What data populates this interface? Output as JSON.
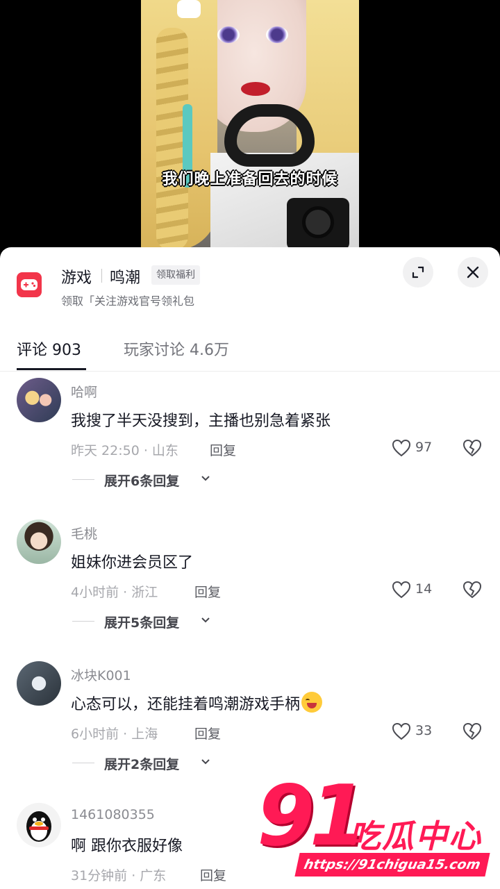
{
  "video": {
    "subtitle": "我们晚上准备回去的时候"
  },
  "game": {
    "icon": "gamepad-icon",
    "name": "游戏",
    "title": "鸣潮",
    "badge": "领取福利",
    "description": "领取「关注游戏官号领礼包"
  },
  "header_buttons": {
    "expand_icon": "expand-icon",
    "close_icon": "close-icon"
  },
  "tabs": [
    {
      "label": "评论 903",
      "active": true
    },
    {
      "label": "玩家讨论 4.6万",
      "active": false
    }
  ],
  "comments": [
    {
      "user": "哈啊",
      "text": "我搜了半天没搜到，主播也别急着紧张",
      "meta": "昨天 22:50 · 山东",
      "reply_label": "回复",
      "likes": "97",
      "expand": "展开6条回复"
    },
    {
      "user": "毛桃",
      "text": "姐妹你进会员区了",
      "meta": "4小时前 · 浙江",
      "reply_label": "回复",
      "likes": "14",
      "expand": "展开5条回复"
    },
    {
      "user": "冰块K001",
      "text": "心态可以，还能挂着鸣潮游戏手柄",
      "emoji": "laughing-crying-emoji",
      "meta": "6小时前 · 上海",
      "reply_label": "回复",
      "likes": "33",
      "expand": "展开2条回复"
    },
    {
      "user": "1461080355",
      "text": "啊 跟你衣服好像",
      "meta": "31分钟前 · 广东",
      "reply_label": "回复"
    }
  ],
  "watermark": {
    "number": "91",
    "text": "吃瓜中心",
    "url": "https://91chigua15.com"
  },
  "colors": {
    "accent": "#f2354a",
    "text_primary": "#161823",
    "text_secondary": "#8a8b91",
    "watermark": "#ff1a55"
  }
}
